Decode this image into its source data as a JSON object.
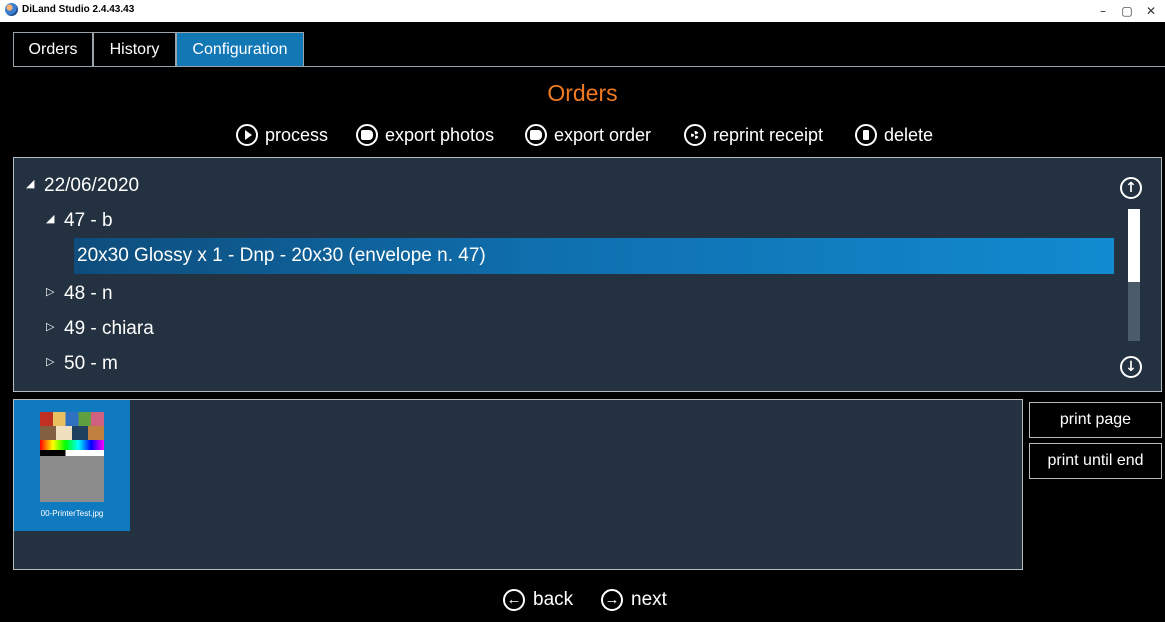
{
  "window": {
    "title": "DiLand Studio 2.4.43.43",
    "minimize": "–",
    "maximize": "▢",
    "close": "✕"
  },
  "tabs": [
    {
      "label": "Orders",
      "active": false
    },
    {
      "label": "History",
      "active": false
    },
    {
      "label": "Configuration",
      "active": true
    }
  ],
  "heading": "Orders",
  "toolbar": {
    "process": "process",
    "export_photos": "export photos",
    "export_order": "export order",
    "reprint_receipt": "reprint receipt",
    "delete": "delete"
  },
  "tree": {
    "date": "22/06/2020",
    "expanded_arrow": "◢",
    "collapsed_arrow": "▷",
    "orders": [
      {
        "label": "47 - b",
        "expanded": true
      },
      {
        "label": "48 - n",
        "expanded": false
      },
      {
        "label": "49 - chiara",
        "expanded": false
      },
      {
        "label": "50 - m",
        "expanded": false
      }
    ],
    "selected_item": "20x30 Glossy x 1 - Dnp - 20x30 (envelope n. 47)"
  },
  "scroll": {
    "up_icon": "↑",
    "down_icon": "↓",
    "position": 0.55
  },
  "thumbnails": [
    {
      "filename": "00-PrinterTest.jpg"
    }
  ],
  "side_buttons": {
    "print_page": "print page",
    "print_until_end": "print until end"
  },
  "nav": {
    "back": "back",
    "next": "next",
    "back_icon": "←",
    "next_icon": "→"
  },
  "colors": {
    "accent": "#1277b5",
    "heading": "#f07a1f",
    "panel": "#233140"
  }
}
